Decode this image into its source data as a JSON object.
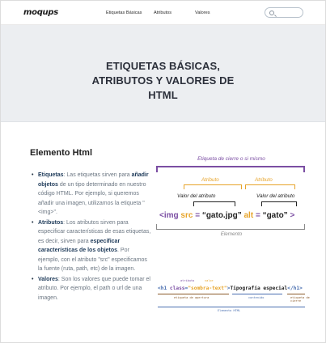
{
  "header": {
    "logo": "moqups",
    "nav": [
      "Etiquetas Básicas",
      "Atributos",
      "Valores"
    ],
    "search": {
      "placeholder": "",
      "value": ""
    }
  },
  "hero": {
    "title_line1": "ETIQUETAS BÁSICAS,",
    "title_line2": "ATRIBUTOS Y VALORES DE",
    "title_line3": "HTML"
  },
  "section": {
    "title": "Elemento Html",
    "items": [
      {
        "term": "Etiquetas",
        "p1": ": Las etiquetas sirven para ",
        "strong": "añadir objetos",
        "p2": " de un tipo determinado en nuestro código HTML. Por ejemplo, si queremos añadir una imagen, utilizamos la etiqueta \"<img>\"."
      },
      {
        "term": "Atributos",
        "p1": ": Los atributos sirven para especificar características de esas etiquetas, es decir, sirven para ",
        "strong": "especificar características de los objetos",
        "p2": ". Por ejemplo, con el atributo \"src\" especificamos la fuente (ruta, path, etc) de la imagen."
      },
      {
        "term": "Valores",
        "p1": ": Son los valores que puede tomar el atributo. Por ejemplo, el path o url de una imagen.",
        "strong": "",
        "p2": ""
      }
    ]
  },
  "diagram1": {
    "top_label": "Etiqueta de cierre o si mismo",
    "attr_label": "Atributo",
    "value_label": "Valor del atributo",
    "code": {
      "open": "<img",
      "attr1": "src",
      "eq1": " = ",
      "val1": "“gato.jpg”",
      "attr2": "alt",
      "eq2": " = ",
      "val2": "“gato”",
      "close": " >"
    },
    "bottom_label": "Elemento",
    "colors": {
      "tag": "#7b4ea3",
      "attribute": "#e7a42a",
      "value": "#222222",
      "element": "#8a8a8a"
    }
  },
  "diagram2": {
    "attr_label": "atributo",
    "value_label": "valor",
    "code": {
      "open": "<h1 ",
      "attr": "class",
      "eq": "=",
      "val": "\"sombra-text\"",
      "gt": ">",
      "text": "Tipografía especial",
      "close": "</h1>"
    },
    "label_open": "etiqueta de apertura",
    "label_content": "contenido",
    "label_close": "etiqueta de cierre",
    "label_element": "Elemento HTML"
  }
}
